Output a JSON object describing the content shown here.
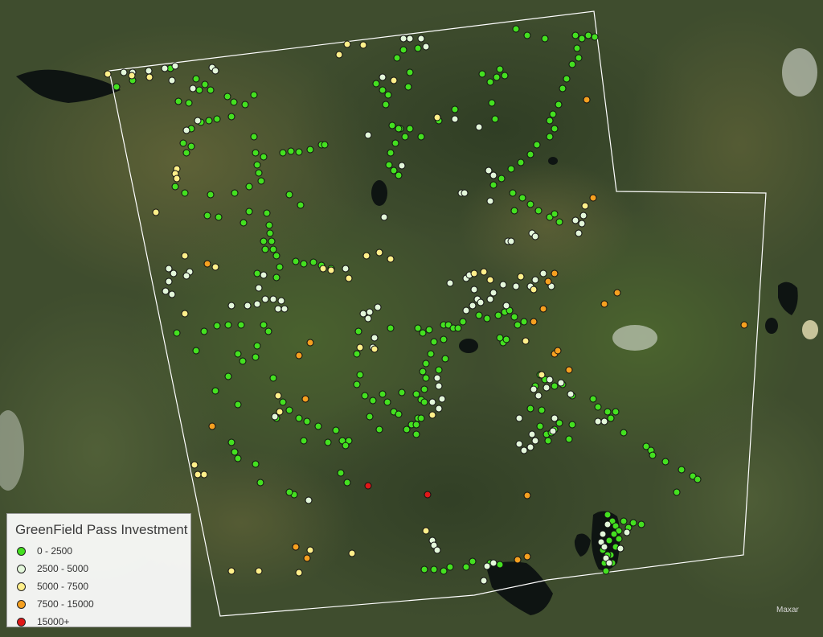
{
  "legend": {
    "title": "GreenField Pass Investment",
    "classes": [
      {
        "label": "0 - 2500",
        "color": "#44e020"
      },
      {
        "label": "2500 - 5000",
        "color": "#e3f7da"
      },
      {
        "label": "5000 - 7500",
        "color": "#ffef8a"
      },
      {
        "label": "7500 - 15000",
        "color": "#f5a020"
      },
      {
        "label": "15000+",
        "color": "#e01818"
      }
    ]
  },
  "attribution": "Maxar",
  "map_style": {
    "boundary_color": "#ffffff",
    "water_color": "#0e1412",
    "marker_outline": "#111111"
  }
}
